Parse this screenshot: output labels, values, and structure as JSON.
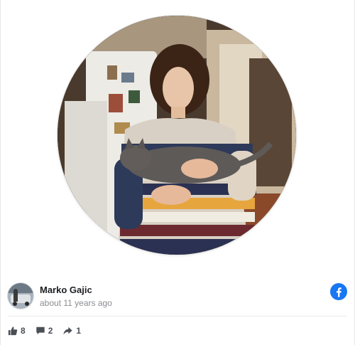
{
  "post": {
    "author_name": "Marko Gajic",
    "timestamp": "about 11 years ago",
    "platform_icon": "facebook-icon",
    "brand_color": "#1877f2"
  },
  "stats": {
    "likes": "8",
    "comments": "2",
    "shares": "1"
  },
  "icons": {
    "likes": "thumbs-up-icon",
    "comments": "comment-icon",
    "shares": "share-arrow-icon"
  }
}
